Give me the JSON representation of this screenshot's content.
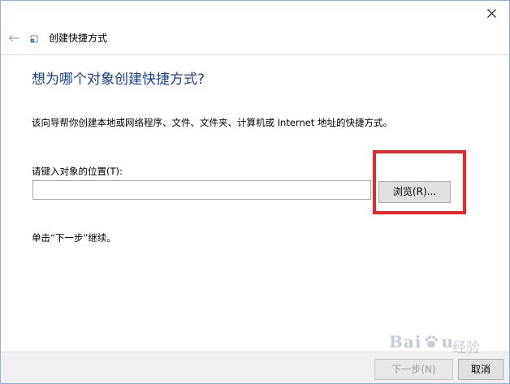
{
  "window": {
    "title": "创建快捷方式"
  },
  "content": {
    "heading": "想为哪个对象创建快捷方式?",
    "description": "该向导帮你创建本地或网络程序、文件、文件夹、计算机或 Internet 地址的快捷方式。",
    "location_label": "请键入对象的位置(T):",
    "location_value": "",
    "browse_label": "浏览(R)...",
    "continue_hint": "单击“下一步”继续。"
  },
  "footer": {
    "next_label": "下一步(N)",
    "cancel_label": "取消"
  },
  "watermark": {
    "logo_text": "Bai",
    "logo_tail": "u",
    "sub_text": "经验"
  },
  "colors": {
    "heading": "#1a3f8f",
    "highlight": "#e8262b",
    "window_border": "#8fb4dc"
  },
  "icons": {
    "close": "close-icon",
    "back": "back-arrow-icon",
    "title": "shortcut-icon",
    "watermark_paw": "paw-icon"
  }
}
